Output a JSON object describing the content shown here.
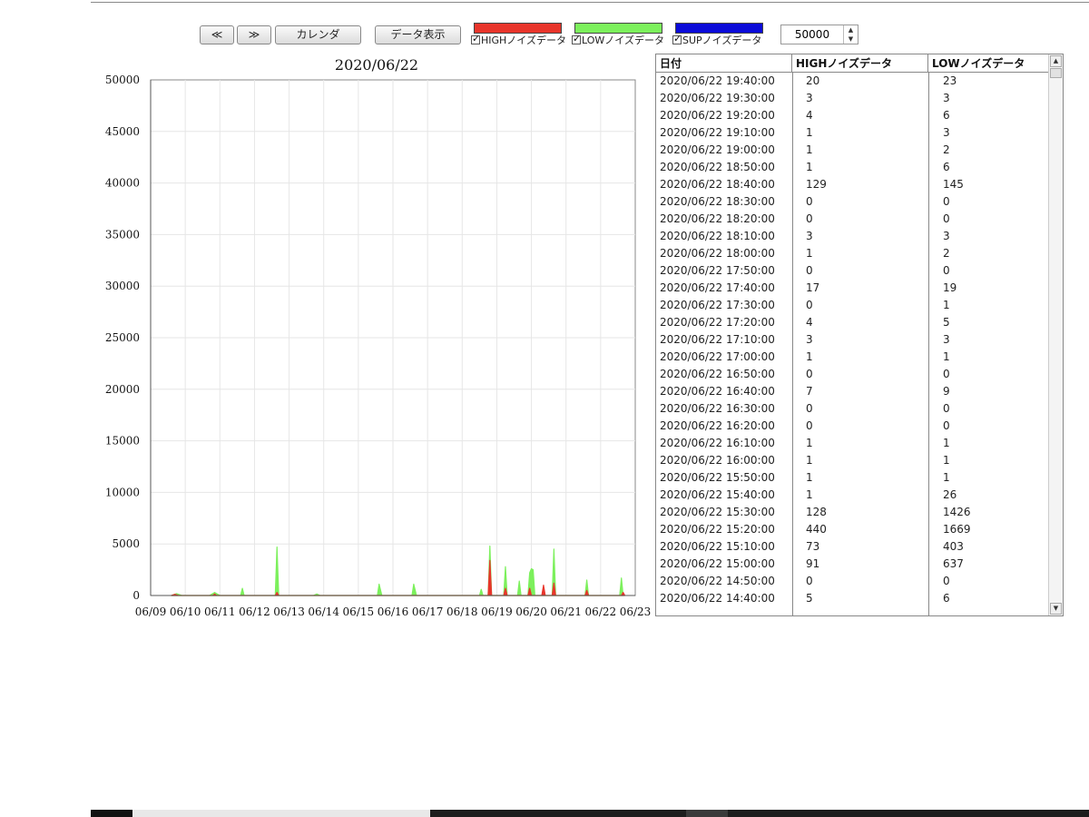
{
  "toolbar": {
    "prev_label": "≪",
    "next_label": "≫",
    "calendar_label": "カレンダ",
    "data_view_label": "データ表示",
    "legends": [
      {
        "label": "HIGHノイズデータ",
        "color": "#e8352b"
      },
      {
        "label": "LOWノイズデータ",
        "color": "#7cf05c"
      },
      {
        "label": "SUPノイズデータ",
        "color": "#0b0bd8"
      }
    ],
    "ymax_value": "50000"
  },
  "chart_title": "2020/06/22",
  "chart_data": {
    "type": "area",
    "title": "2020/06/22",
    "xlabel": "",
    "ylabel": "",
    "ylim": [
      0,
      50000
    ],
    "y_ticks": [
      0,
      5000,
      10000,
      15000,
      20000,
      25000,
      30000,
      35000,
      40000,
      45000,
      50000
    ],
    "x_ticks": [
      "06/09",
      "06/10",
      "06/11",
      "06/12",
      "06/13",
      "06/14",
      "06/15",
      "06/16",
      "06/17",
      "06/18",
      "06/19",
      "06/20",
      "06/21",
      "06/22",
      "06/23"
    ],
    "xlim": [
      0,
      14
    ],
    "grid": true,
    "legend": "top",
    "series": [
      {
        "name": "LOWノイズデータ",
        "color": "#7cf05c",
        "points": [
          [
            0.6,
            0
          ],
          [
            0.75,
            180
          ],
          [
            0.9,
            0
          ],
          [
            1.7,
            0
          ],
          [
            1.85,
            300
          ],
          [
            2.0,
            0
          ],
          [
            2.6,
            0
          ],
          [
            2.65,
            700
          ],
          [
            2.7,
            0
          ],
          [
            3.6,
            0
          ],
          [
            3.65,
            4700
          ],
          [
            3.7,
            0
          ],
          [
            4.7,
            0
          ],
          [
            4.8,
            150
          ],
          [
            4.9,
            0
          ],
          [
            6.55,
            0
          ],
          [
            6.6,
            1100
          ],
          [
            6.68,
            0
          ],
          [
            7.55,
            0
          ],
          [
            7.6,
            1100
          ],
          [
            7.68,
            0
          ],
          [
            9.5,
            0
          ],
          [
            9.55,
            600
          ],
          [
            9.6,
            0
          ],
          [
            9.75,
            0
          ],
          [
            9.8,
            4800
          ],
          [
            9.85,
            0
          ],
          [
            10.2,
            0
          ],
          [
            10.25,
            2800
          ],
          [
            10.3,
            0
          ],
          [
            10.6,
            0
          ],
          [
            10.65,
            1400
          ],
          [
            10.7,
            0
          ],
          [
            10.9,
            0
          ],
          [
            10.95,
            2200
          ],
          [
            11.0,
            2600
          ],
          [
            11.05,
            2500
          ],
          [
            11.1,
            0
          ],
          [
            11.6,
            0
          ],
          [
            11.65,
            4500
          ],
          [
            11.7,
            0
          ],
          [
            12.55,
            0
          ],
          [
            12.6,
            1500
          ],
          [
            12.65,
            0
          ],
          [
            13.55,
            0
          ],
          [
            13.6,
            1700
          ],
          [
            13.65,
            0
          ]
        ]
      },
      {
        "name": "HIGHノイズデータ",
        "color": "#e8352b",
        "points": [
          [
            0.6,
            0
          ],
          [
            0.7,
            120
          ],
          [
            0.8,
            0
          ],
          [
            1.8,
            0
          ],
          [
            1.85,
            150
          ],
          [
            1.9,
            0
          ],
          [
            3.6,
            0
          ],
          [
            3.65,
            300
          ],
          [
            3.7,
            0
          ],
          [
            9.75,
            0
          ],
          [
            9.8,
            3400
          ],
          [
            9.85,
            0
          ],
          [
            10.2,
            0
          ],
          [
            10.25,
            700
          ],
          [
            10.3,
            0
          ],
          [
            10.9,
            0
          ],
          [
            10.95,
            700
          ],
          [
            11.0,
            0
          ],
          [
            11.3,
            0
          ],
          [
            11.35,
            1000
          ],
          [
            11.4,
            0
          ],
          [
            11.6,
            0
          ],
          [
            11.65,
            1200
          ],
          [
            11.7,
            0
          ],
          [
            12.55,
            0
          ],
          [
            12.6,
            500
          ],
          [
            12.65,
            0
          ],
          [
            13.6,
            0
          ],
          [
            13.65,
            300
          ],
          [
            13.7,
            0
          ]
        ]
      }
    ]
  },
  "table": {
    "headers": [
      "日付",
      "HIGHノイズデータ",
      "LOWノイズデータ"
    ],
    "rows": [
      [
        "2020/06/22 19:40:00",
        "20",
        "23"
      ],
      [
        "2020/06/22 19:30:00",
        "3",
        "3"
      ],
      [
        "2020/06/22 19:20:00",
        "4",
        "6"
      ],
      [
        "2020/06/22 19:10:00",
        "1",
        "3"
      ],
      [
        "2020/06/22 19:00:00",
        "1",
        "2"
      ],
      [
        "2020/06/22 18:50:00",
        "1",
        "6"
      ],
      [
        "2020/06/22 18:40:00",
        "129",
        "145"
      ],
      [
        "2020/06/22 18:30:00",
        "0",
        "0"
      ],
      [
        "2020/06/22 18:20:00",
        "0",
        "0"
      ],
      [
        "2020/06/22 18:10:00",
        "3",
        "3"
      ],
      [
        "2020/06/22 18:00:00",
        "1",
        "2"
      ],
      [
        "2020/06/22 17:50:00",
        "0",
        "0"
      ],
      [
        "2020/06/22 17:40:00",
        "17",
        "19"
      ],
      [
        "2020/06/22 17:30:00",
        "0",
        "1"
      ],
      [
        "2020/06/22 17:20:00",
        "4",
        "5"
      ],
      [
        "2020/06/22 17:10:00",
        "3",
        "3"
      ],
      [
        "2020/06/22 17:00:00",
        "1",
        "1"
      ],
      [
        "2020/06/22 16:50:00",
        "0",
        "0"
      ],
      [
        "2020/06/22 16:40:00",
        "7",
        "9"
      ],
      [
        "2020/06/22 16:30:00",
        "0",
        "0"
      ],
      [
        "2020/06/22 16:20:00",
        "0",
        "0"
      ],
      [
        "2020/06/22 16:10:00",
        "1",
        "1"
      ],
      [
        "2020/06/22 16:00:00",
        "1",
        "1"
      ],
      [
        "2020/06/22 15:50:00",
        "1",
        "1"
      ],
      [
        "2020/06/22 15:40:00",
        "1",
        "26"
      ],
      [
        "2020/06/22 15:30:00",
        "128",
        "1426"
      ],
      [
        "2020/06/22 15:20:00",
        "440",
        "1669"
      ],
      [
        "2020/06/22 15:10:00",
        "73",
        "403"
      ],
      [
        "2020/06/22 15:00:00",
        "91",
        "637"
      ],
      [
        "2020/06/22 14:50:00",
        "0",
        "0"
      ],
      [
        "2020/06/22 14:40:00",
        "5",
        "6"
      ]
    ]
  }
}
